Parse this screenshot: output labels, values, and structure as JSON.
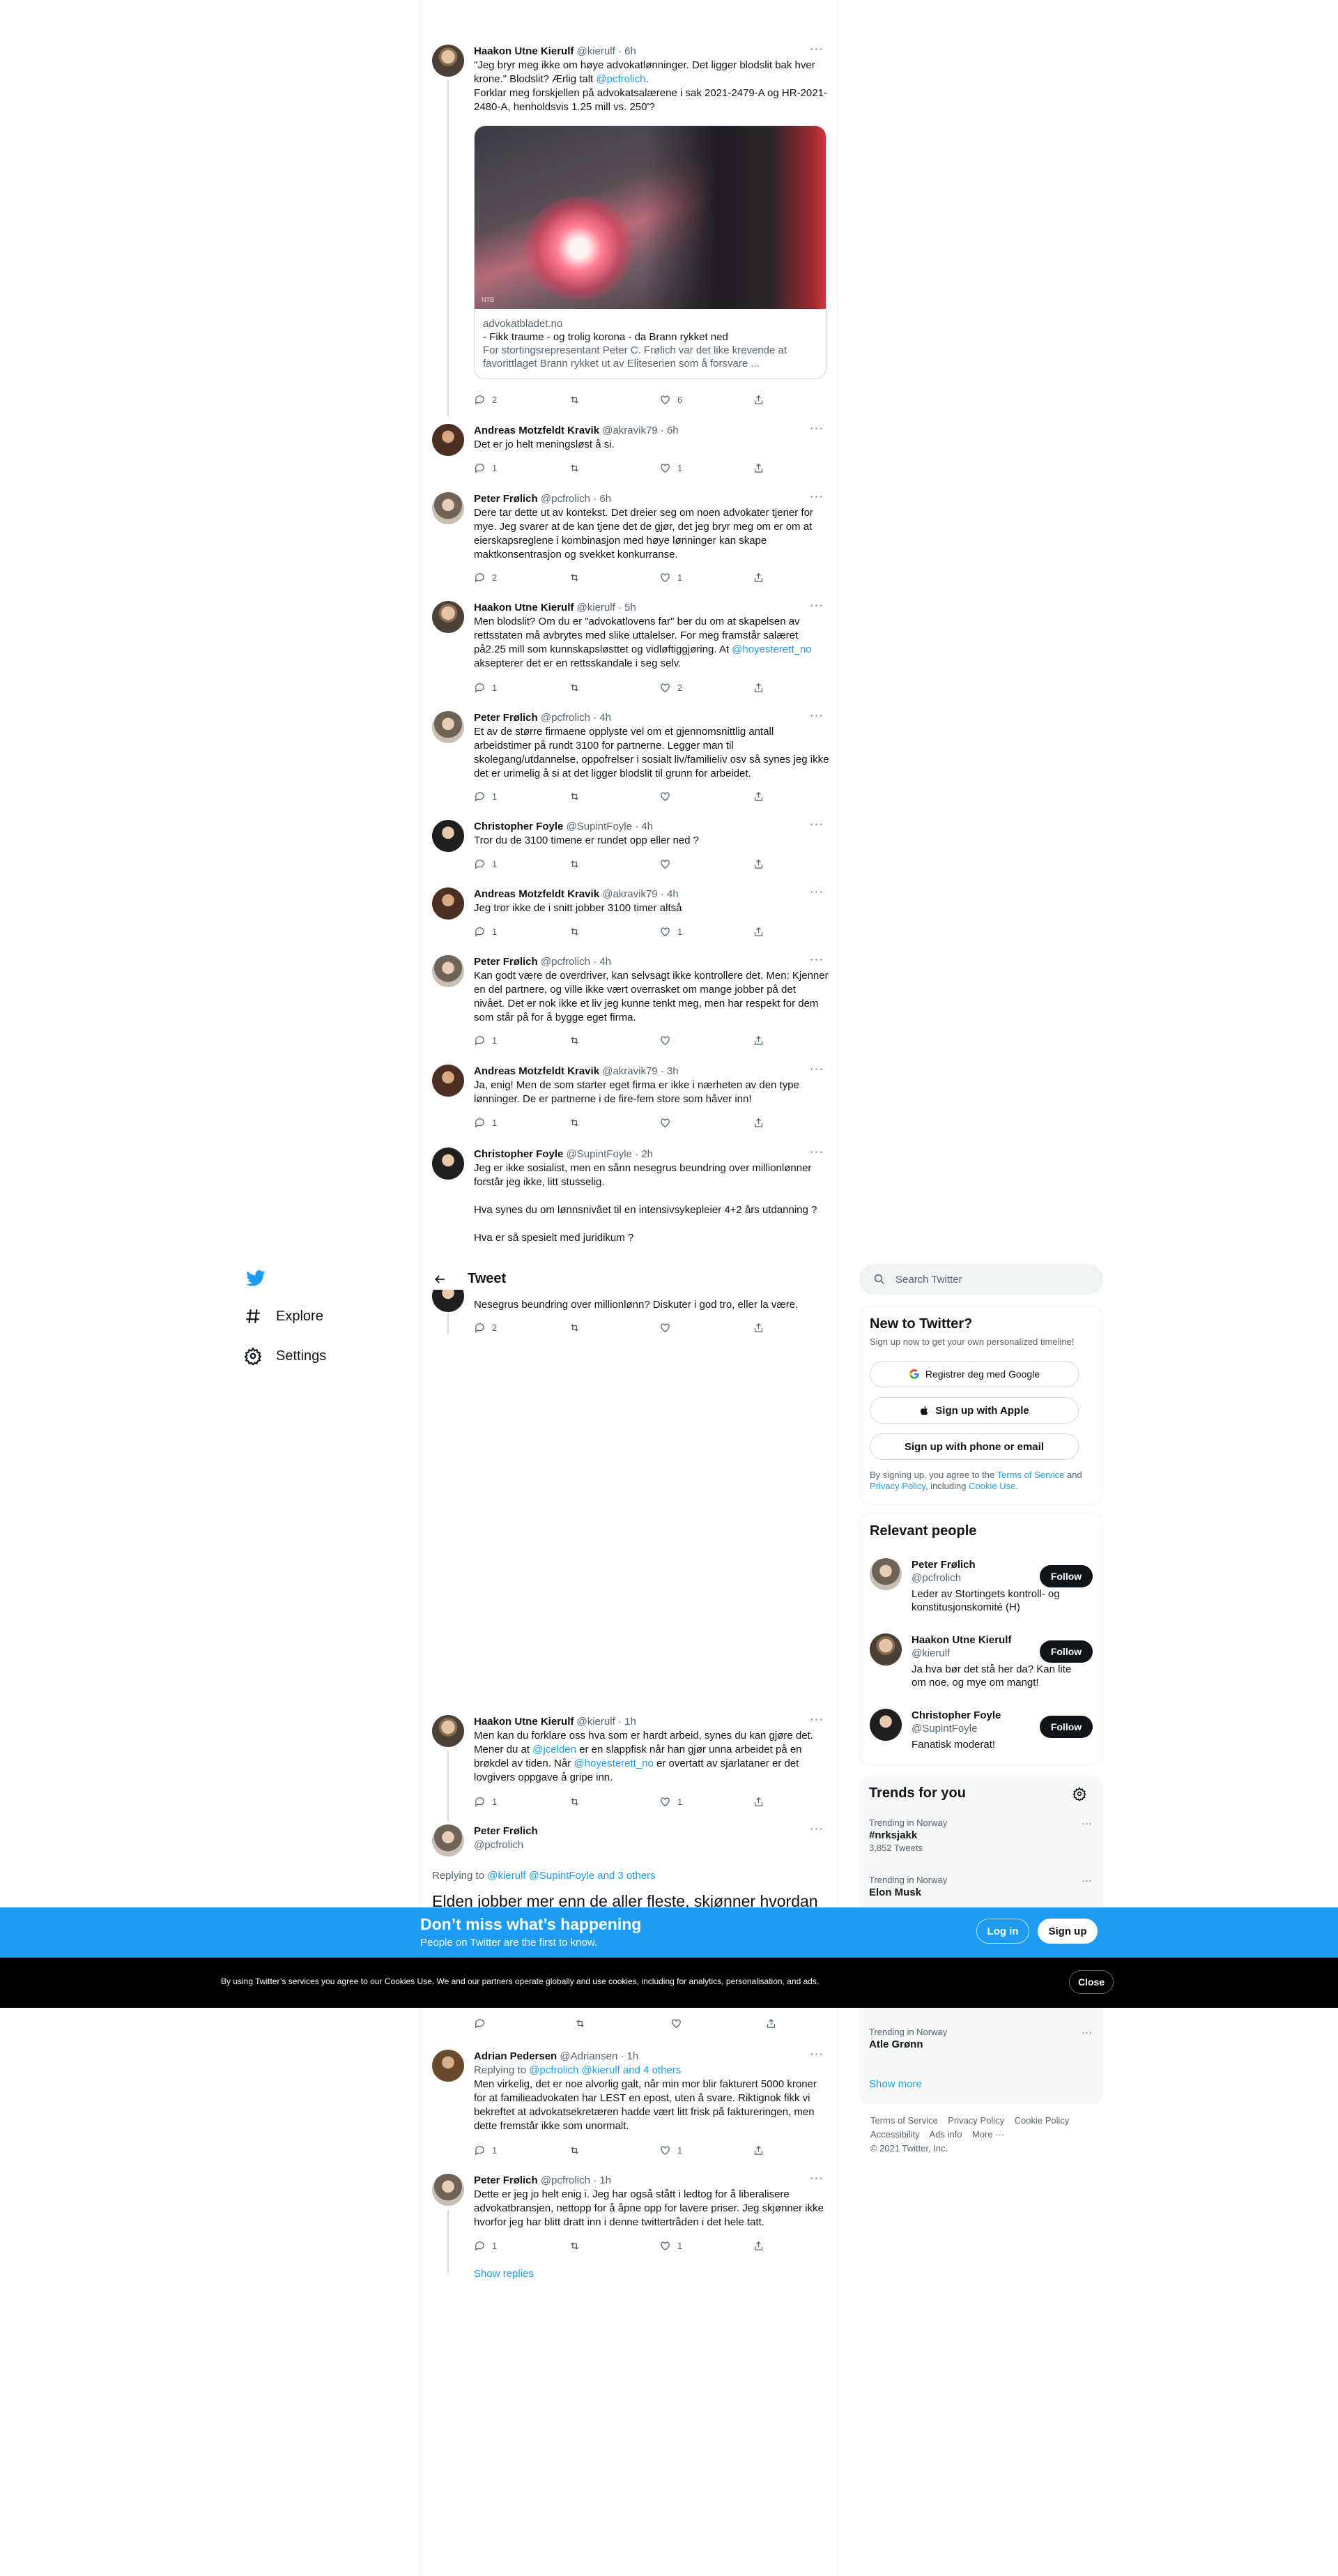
{
  "header": {
    "title": "Tweet"
  },
  "nav": {
    "items": [
      {
        "label": "Explore"
      },
      {
        "label": "Settings"
      }
    ]
  },
  "tweets": [
    {
      "name": "Haakon Utne Kierulf",
      "handle": "@kierulf",
      "time": "6h",
      "text": [
        "\"Jeg bryr meg ikke om høye advokatlønninger. Det ligger blodslit bak hver krone.\" Blodslit? Ærlig talt ",
        "@pcfrolich",
        ".",
        "Forklar meg forskjellen på advokatsalærene i sak 2021-2479-A og HR-2021-2480-A, henholdsvis 1.25 mill vs. 250'?"
      ],
      "card": {
        "domain": "advokatbladet.no",
        "title": "- Fikk traume - og trolig korona - da Brann rykket ned",
        "desc": "For stortingsrepresentant Peter C. Frølich var det like krevende at favorittlaget Brann rykket ut av Eliteserien som å forsvare ...",
        "watermark": "NTB"
      },
      "replies": "2",
      "retweets": "",
      "likes": "6"
    },
    {
      "name": "Andreas Motzfeldt Kravik",
      "handle": "@akravik79",
      "time": "6h",
      "text": "Det er jo helt meningsløst å si.",
      "replies": "1",
      "retweets": "",
      "likes": "1"
    },
    {
      "name": "Peter Frølich",
      "handle": "@pcfrolich",
      "time": "6h",
      "text": "Dere tar dette ut av kontekst. Det dreier seg om noen advokater tjener for mye. Jeg svarer at de kan tjene det de gjør, det jeg bryr meg om er om at eierskapsreglene i kombinasjon med høye lønninger kan skape maktkonsentrasjon og svekket konkurranse.",
      "replies": "2",
      "retweets": "",
      "likes": "1"
    },
    {
      "name": "Haakon Utne Kierulf",
      "handle": "@kierulf",
      "time": "5h",
      "text": [
        "Men blodslit? Om du er \"advokatlovens far\" ber du om at skapelsen av rettsstaten må avbrytes med slike uttalelser. For meg framstår salæret på2.25 mill som kunnskapsløsttet og vidløftiggjøring. At ",
        "@hoyesterett_no",
        " aksepterer det er en rettsskandale i seg selv."
      ],
      "replies": "1",
      "retweets": "",
      "likes": "2"
    },
    {
      "name": "Peter Frølich",
      "handle": "@pcfrolich",
      "time": "4h",
      "text": "Et av de større firmaene opplyste vel om et gjennomsnittlig antall arbeidstimer på rundt 3100 for partnerne. Legger man til skolegang/utdannelse, oppofrelser i sosialt liv/familieliv osv så synes jeg ikke det er urimelig å si at det ligger blodslit til grunn for arbeidet.",
      "replies": "1",
      "retweets": "",
      "likes": ""
    },
    {
      "name": "Christopher Foyle",
      "handle": "@SupintFoyle",
      "time": "4h",
      "text": "Tror du de 3100 timene er rundet opp eller ned ?",
      "replies": "1",
      "retweets": "",
      "likes": ""
    },
    {
      "name": "Andreas Motzfeldt Kravik",
      "handle": "@akravik79",
      "time": "4h",
      "text": "Jeg tror ikke de i snitt jobber 3100 timer altså",
      "replies": "1",
      "retweets": "",
      "likes": "1"
    },
    {
      "name": "Peter Frølich",
      "handle": "@pcfrolich",
      "time": "4h",
      "text": "Kan godt være de overdriver, kan selvsagt ikke kontrollere det. Men: Kjenner en del partnere, og ville ikke vært overrasket om mange jobber på det nivået. Det er nok ikke et liv jeg kunne tenkt meg, men har respekt for dem som står på for å bygge eget firma.",
      "replies": "1",
      "retweets": "",
      "likes": ""
    },
    {
      "name": "Andreas Motzfeldt Kravik",
      "handle": "@akravik79",
      "time": "3h",
      "text": "Ja, enig! Men de som starter eget firma er ikke i nærheten av den type lønninger. De er partnerne i de fire-fem store som håver inn!",
      "replies": "1",
      "retweets": "",
      "likes": ""
    },
    {
      "name": "Christopher Foyle",
      "handle": "@SupintFoyle",
      "time": "2h",
      "text": "Jeg er ikke sosialist, men en sånn nesegrus beundring over millionlønner forstår jeg ikke, litt stusselig.\n\nHva synes du om lønnsnivået til en intensivsykepleier 4+2 års utdanning ?\n\nHva er så spesielt med juridikum ?",
      "replies": "",
      "retweets": "",
      "likes": ""
    },
    {
      "text": "Nesegrus beundring over millionlønn? Diskuter i god tro, eller la være.",
      "replies": "2",
      "retweets": "",
      "likes": ""
    },
    {
      "name": "Haakon Utne Kierulf",
      "handle": "@kierulf",
      "time": "1h",
      "text": [
        "Men kan du forklare oss hva som er hardt arbeid, synes du kan gjøre det. Mener du at ",
        "@jcelden",
        " er en slappfisk når han gjør unna arbeidet på en brøkdel av tiden. Når ",
        "@hoyesterett_no",
        " er overtatt av sjarlataner er det lovgivers oppgave å gripe inn."
      ],
      "replies": "1",
      "retweets": "",
      "likes": "1"
    },
    {
      "name": "Peter Frølich",
      "handle": "@pcfrolich",
      "replying_prefix": "Replying to ",
      "replying_to": "@kierulf @SupintFoyle and 3 others",
      "text": "Elden jobber mer enn de aller fleste, skjønner hvordan"
    },
    {
      "name": "Adrian Pedersen",
      "handle": "@Adriansen",
      "time": "1h",
      "replying_prefix": "Replying to ",
      "replying_to": "@pcfrolich @kierulf and 4 others",
      "text": "Men virkelig, det er noe alvorlig galt, når min mor blir fakturert 5000 kroner for at familieadvokaten har LEST en epost, uten å svare. Riktignok fikk vi bekreftet at advokatsekretæren hadde vært litt frisk på faktureringen, men dette fremstår ikke som unormalt.",
      "replies": "1",
      "retweets": "",
      "likes": "1"
    },
    {
      "name": "Peter Frølich",
      "handle": "@pcfrolich",
      "time": "1h",
      "text": "Dette er jeg jo helt enig i. Jeg har også stått i ledtog for å liberalisere advokatbransjen, nettopp for å åpne opp for lavere priser. Jeg skjønner ikke hvorfor jeg har blitt dratt inn i denne twittertråden i det hele tatt.",
      "replies": "1",
      "retweets": "",
      "likes": "1"
    }
  ],
  "show_replies": "Show replies",
  "search": {
    "placeholder": "Search Twitter"
  },
  "signup": {
    "title": "New to Twitter?",
    "subtitle": "Sign up now to get your own personalized timeline!",
    "google": "Registrer deg med Google",
    "apple": "Sign up with Apple",
    "phone": "Sign up with phone or email",
    "legal": [
      "By signing up, you agree to the ",
      "Terms of Service",
      " and ",
      "Privacy Policy",
      ", including ",
      "Cookie Use",
      "."
    ]
  },
  "relevant": {
    "title": "Relevant people",
    "follow": "Follow",
    "people": [
      {
        "name": "Peter Frølich",
        "handle": "@pcfrolich",
        "bio": "Leder av Stortingets kontroll- og konstitusjonskomité (H)"
      },
      {
        "name": "Haakon Utne Kierulf",
        "handle": "@kierulf",
        "bio": "Ja hva bør det stå her da? Kan lite om noe, og mye om mangt!"
      },
      {
        "name": "Christopher Foyle",
        "handle": "@SupintFoyle",
        "bio": "Fanatisk moderat!"
      }
    ]
  },
  "trends": {
    "title": "Trends for you",
    "items": [
      {
        "location": "Trending in Norway",
        "name": "#nrksjakk",
        "count": "3,852 Tweets"
      },
      {
        "location": "Trending in Norway",
        "name": "Elon Musk",
        "count": ""
      },
      {
        "location": "Trending in Norway",
        "name": "Atle Grønn",
        "count": ""
      }
    ],
    "show_more": "Show more"
  },
  "footer": [
    "Terms of Service",
    "Privacy Policy",
    "Cookie Policy",
    "Accessibility",
    "Ads info",
    "More ···",
    "© 2021 Twitter, Inc."
  ],
  "banner": {
    "title": "Don’t miss what’s happening",
    "subtitle": "People on Twitter are the first to know.",
    "login": "Log in",
    "signup": "Sign up"
  },
  "cookie": {
    "text": "By using Twitter’s services you agree to our Cookies Use. We and our partners operate globally and use cookies, including for analytics, personalisation, and ads.",
    "close": "Close"
  }
}
